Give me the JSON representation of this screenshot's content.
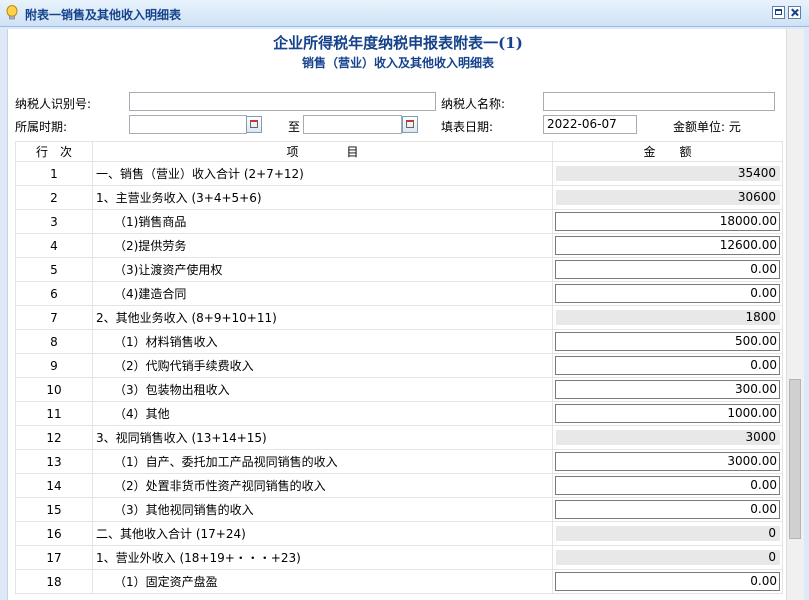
{
  "window": {
    "title": "附表一销售及其他收入明细表"
  },
  "heading": {
    "title": "企业所得税年度纳税申报表附表一(1)",
    "subtitle": "销售（营业）收入及其他收入明细表"
  },
  "form": {
    "taxpayer_id_label": "纳税人识别号:",
    "taxpayer_id_value": "",
    "taxpayer_name_label": "纳税人名称:",
    "taxpayer_name_value": "",
    "period_label": "所属时期:",
    "period_from": "",
    "period_to_label": "至",
    "period_to": "",
    "fill_date_label": "填表日期:",
    "fill_date_value": "2022-06-07",
    "unit_label": "金额单位: 元"
  },
  "table": {
    "headers": [
      "行　次",
      "项　　　　目",
      "金　　额"
    ],
    "rows": [
      {
        "no": "1",
        "item": "一、销售（营业）收入合计 (2+7+12)",
        "amount": "35400",
        "editable": false
      },
      {
        "no": "2",
        "item": "1、主营业务收入 (3+4+5+6)",
        "amount": "30600",
        "editable": false
      },
      {
        "no": "3",
        "item": "　　（1)销售商品",
        "amount": "18000.00",
        "editable": true
      },
      {
        "no": "4",
        "item": "　　（2)提供劳务",
        "amount": "12600.00",
        "editable": true
      },
      {
        "no": "5",
        "item": "　　（3)让渡资产使用权",
        "amount": "0.00",
        "editable": true
      },
      {
        "no": "6",
        "item": "　　（4)建造合同",
        "amount": "0.00",
        "editable": true
      },
      {
        "no": "7",
        "item": "2、其他业务收入 (8+9+10+11)",
        "amount": "1800",
        "editable": false
      },
      {
        "no": "8",
        "item": "　　（1）材料销售收入",
        "amount": "500.00",
        "editable": true
      },
      {
        "no": "9",
        "item": "　　（2）代购代销手续费收入",
        "amount": "0.00",
        "editable": true
      },
      {
        "no": "10",
        "item": "　　（3）包装物出租收入",
        "amount": "300.00",
        "editable": true
      },
      {
        "no": "11",
        "item": "　　（4）其他",
        "amount": "1000.00",
        "editable": true
      },
      {
        "no": "12",
        "item": "3、视同销售收入 (13+14+15)",
        "amount": "3000",
        "editable": false
      },
      {
        "no": "13",
        "item": "　　（1）自产、委托加工产品视同销售的收入",
        "amount": "3000.00",
        "editable": true
      },
      {
        "no": "14",
        "item": "　　（2）处置非货币性资产视同销售的收入",
        "amount": "0.00",
        "editable": true
      },
      {
        "no": "15",
        "item": "　　（3）其他视同销售的收入",
        "amount": "0.00",
        "editable": true
      },
      {
        "no": "16",
        "item": "二、其他收入合计 (17+24)",
        "amount": "0",
        "editable": false
      },
      {
        "no": "17",
        "item": "1、营业外收入 (18+19+・・・+23)",
        "amount": "0",
        "editable": false
      },
      {
        "no": "18",
        "item": "　　（1）固定资产盘盈",
        "amount": "0.00",
        "editable": true
      }
    ]
  }
}
